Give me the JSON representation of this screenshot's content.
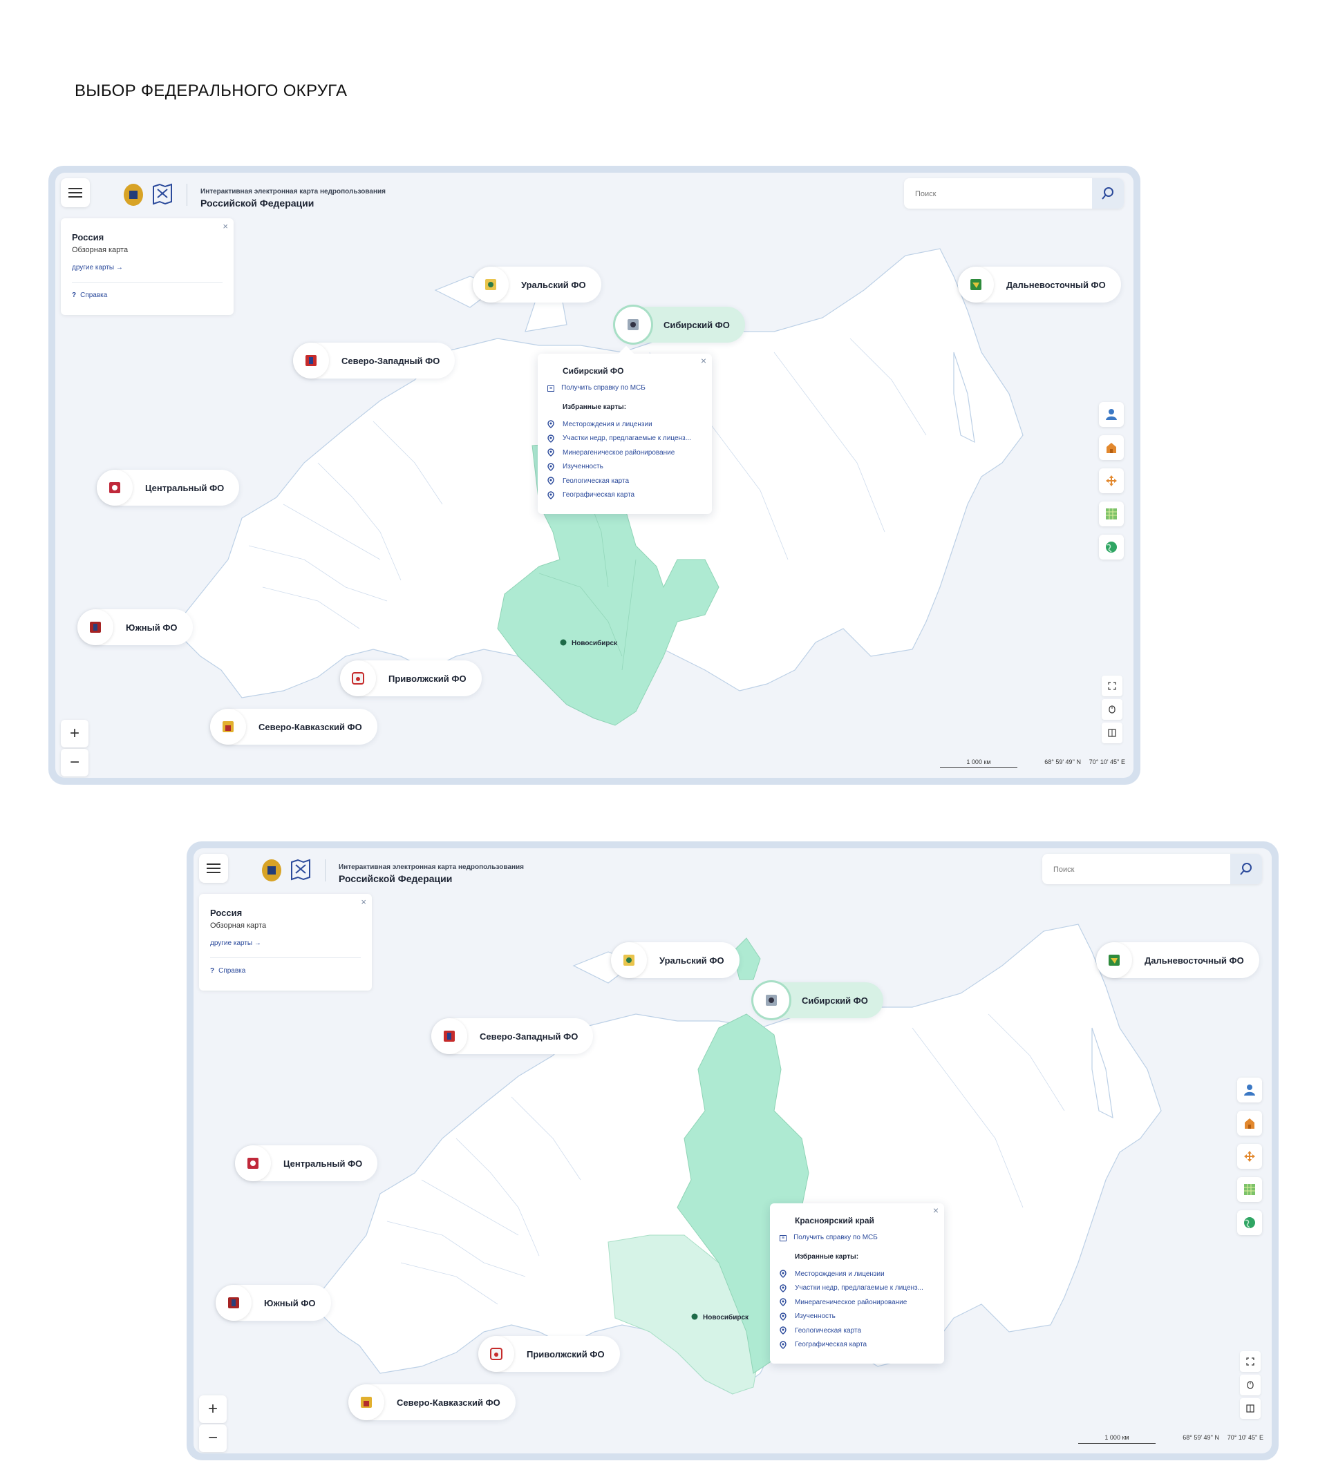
{
  "page_heading": "ВЫБОР ФЕДЕРАЛЬНОГО ОКРУГА",
  "app": {
    "title_small": "Интерактивная электронная карта недропользования",
    "title_big": "Российской Федерации",
    "search_placeholder": "Поиск"
  },
  "info_panel": {
    "close": "×",
    "title": "Россия",
    "subtitle": "Обзорная карта",
    "other_maps": "другие карты",
    "help": "Справка"
  },
  "districts": {
    "ural": "Уральский ФО",
    "siberian": "Сибирский ФО",
    "far_east": "Дальневосточный ФО",
    "north_west": "Северо-Западный ФО",
    "central": "Центральный ФО",
    "southern": "Южный ФО",
    "volga": "Приволжский ФО",
    "north_caucasus": "Северо-Кавказский ФО"
  },
  "popup_1": {
    "title": "Сибирский ФО",
    "report": "Получить справку по МСБ",
    "favorites_title": "Избранные карты:",
    "items": [
      "Месторождения и лицензии",
      "Участки недр, предлагаемые к лиценз...",
      "Минерагеническое районирование",
      "Изученность",
      "Геологическая карта",
      "Географическая карта"
    ]
  },
  "popup_2": {
    "title": "Красноярский край",
    "report": "Получить справку по МСБ",
    "favorites_title": "Избранные карты:",
    "items": [
      "Месторождения и лицензии",
      "Участки недр, предлагаемые к лиценз...",
      "Минерагеническое районирование",
      "Изученность",
      "Геологическая карта",
      "Географическая карта"
    ]
  },
  "city": "Новосибирск",
  "zoom": {
    "in": "+",
    "out": "−"
  },
  "scale_label": "1 000 км",
  "coords": {
    "lat": "68° 59' 49'' N",
    "lon": "70° 10' 45'' E"
  },
  "colors": {
    "selected_region": "#aeead2",
    "selected_subregion": "#d6f3e7",
    "map_bg": "#f1f4f9",
    "link": "#2b4a9b",
    "accent_orange": "#e2882e"
  },
  "tool_icons": [
    "user-icon",
    "building-icon",
    "move-icon",
    "grid-icon",
    "globe-icon"
  ]
}
